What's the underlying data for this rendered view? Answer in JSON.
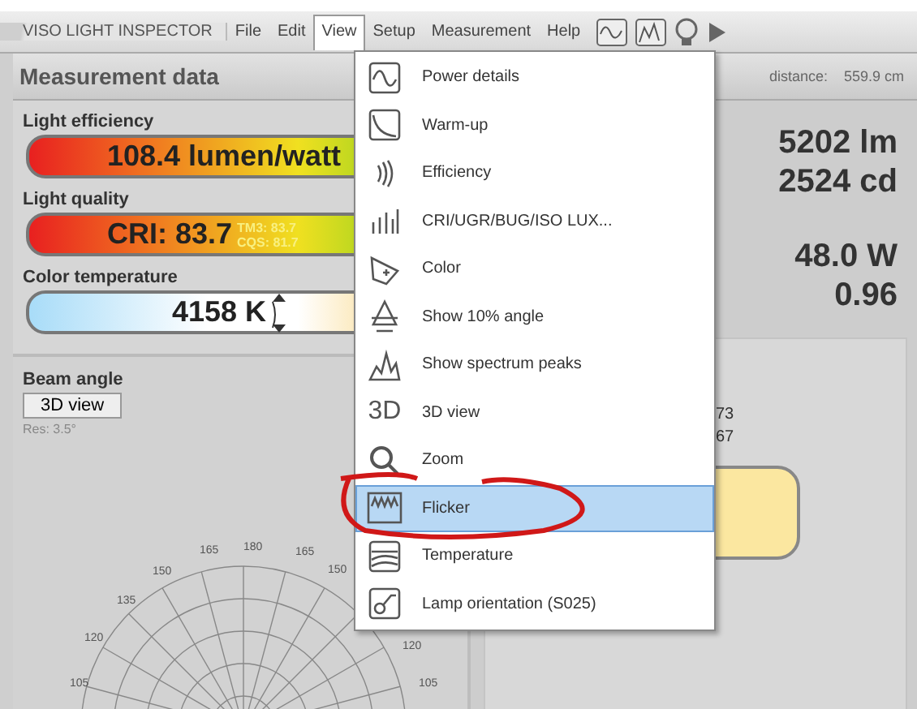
{
  "menu_bar": {
    "app_title": "VISO LIGHT INSPECTOR",
    "menus": [
      {
        "label": "File",
        "selected": false
      },
      {
        "label": "Edit",
        "selected": false
      },
      {
        "label": "View",
        "selected": true
      },
      {
        "label": "Setup",
        "selected": false
      },
      {
        "label": "Measurement",
        "selected": false
      },
      {
        "label": "Help",
        "selected": false
      }
    ]
  },
  "left_panel": {
    "title": "Measurement data",
    "light_efficiency": {
      "label": "Light efficiency",
      "value": "108.4 lumen/watt"
    },
    "light_quality": {
      "label": "Light quality",
      "value": "CRI: 83.7",
      "tm3": "TM3: 83.7",
      "cqs": "CQS: 81.7"
    },
    "color_temperature": {
      "label": "Color temperature",
      "value": "4158 K"
    },
    "beam": {
      "label": "Beam angle",
      "button": "3D view",
      "resolution": "Res: 3.5°",
      "angle_labels": [
        "165",
        "180",
        "165",
        "150",
        "150",
        "135",
        "120",
        "105",
        "120",
        "105"
      ]
    }
  },
  "right_panel": {
    "distance_label": "distance:",
    "distance_value": "559.9 cm",
    "values": [
      "5202 lm",
      "2524 cd",
      "48.0 W",
      "0.96"
    ],
    "partial_values": [
      "73",
      "67"
    ]
  },
  "view_menu": {
    "items": [
      {
        "label": "Power details",
        "selected": false
      },
      {
        "label": "Warm-up",
        "selected": false
      },
      {
        "label": "Efficiency",
        "selected": false
      },
      {
        "label": "CRI/UGR/BUG/ISO LUX...",
        "selected": false
      },
      {
        "label": "Color",
        "selected": false
      },
      {
        "label": "Show 10% angle",
        "selected": false
      },
      {
        "label": "Show spectrum peaks",
        "selected": false
      },
      {
        "label": "3D view",
        "selected": false,
        "icon_text": "3D"
      },
      {
        "label": "Zoom",
        "selected": false
      },
      {
        "label": "Flicker",
        "selected": true
      },
      {
        "label": "Temperature",
        "selected": false
      },
      {
        "label": "Lamp orientation (S025)",
        "selected": false
      }
    ]
  }
}
